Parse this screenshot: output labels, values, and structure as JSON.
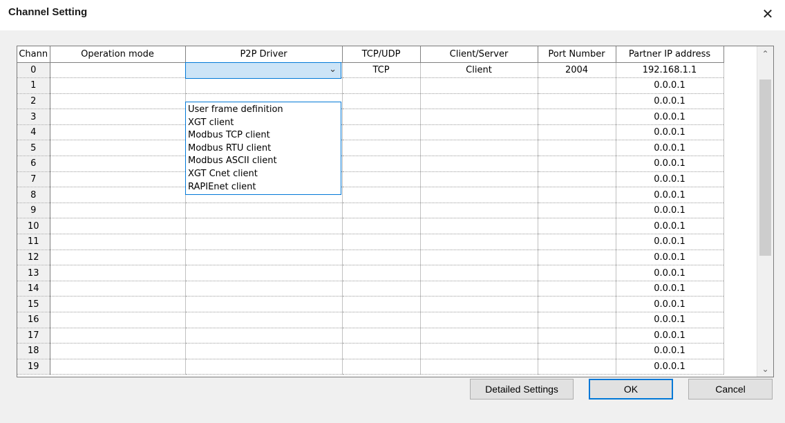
{
  "window": {
    "title": "Channel Setting",
    "close_glyph": "✕"
  },
  "grid": {
    "columns": [
      "Chann",
      "Operation mode",
      "P2P Driver",
      "TCP/UDP",
      "Client/Server",
      "Port Number",
      "Partner IP address"
    ],
    "rows": [
      {
        "channel": "0",
        "operation_mode": "",
        "p2p_driver": "",
        "tcp_udp": "TCP",
        "client_server": "Client",
        "port_number": "2004",
        "partner_ip": "192.168.1.1"
      },
      {
        "channel": "1",
        "operation_mode": "",
        "p2p_driver": "",
        "tcp_udp": "",
        "client_server": "",
        "port_number": "",
        "partner_ip": "0.0.0.1"
      },
      {
        "channel": "2",
        "operation_mode": "",
        "p2p_driver": "",
        "tcp_udp": "",
        "client_server": "",
        "port_number": "",
        "partner_ip": "0.0.0.1"
      },
      {
        "channel": "3",
        "operation_mode": "",
        "p2p_driver": "",
        "tcp_udp": "",
        "client_server": "",
        "port_number": "",
        "partner_ip": "0.0.0.1"
      },
      {
        "channel": "4",
        "operation_mode": "",
        "p2p_driver": "",
        "tcp_udp": "",
        "client_server": "",
        "port_number": "",
        "partner_ip": "0.0.0.1"
      },
      {
        "channel": "5",
        "operation_mode": "",
        "p2p_driver": "",
        "tcp_udp": "",
        "client_server": "",
        "port_number": "",
        "partner_ip": "0.0.0.1"
      },
      {
        "channel": "6",
        "operation_mode": "",
        "p2p_driver": "",
        "tcp_udp": "",
        "client_server": "",
        "port_number": "",
        "partner_ip": "0.0.0.1"
      },
      {
        "channel": "7",
        "operation_mode": "",
        "p2p_driver": "",
        "tcp_udp": "",
        "client_server": "",
        "port_number": "",
        "partner_ip": "0.0.0.1"
      },
      {
        "channel": "8",
        "operation_mode": "",
        "p2p_driver": "",
        "tcp_udp": "",
        "client_server": "",
        "port_number": "",
        "partner_ip": "0.0.0.1"
      },
      {
        "channel": "9",
        "operation_mode": "",
        "p2p_driver": "",
        "tcp_udp": "",
        "client_server": "",
        "port_number": "",
        "partner_ip": "0.0.0.1"
      },
      {
        "channel": "10",
        "operation_mode": "",
        "p2p_driver": "",
        "tcp_udp": "",
        "client_server": "",
        "port_number": "",
        "partner_ip": "0.0.0.1"
      },
      {
        "channel": "11",
        "operation_mode": "",
        "p2p_driver": "",
        "tcp_udp": "",
        "client_server": "",
        "port_number": "",
        "partner_ip": "0.0.0.1"
      },
      {
        "channel": "12",
        "operation_mode": "",
        "p2p_driver": "",
        "tcp_udp": "",
        "client_server": "",
        "port_number": "",
        "partner_ip": "0.0.0.1"
      },
      {
        "channel": "13",
        "operation_mode": "",
        "p2p_driver": "",
        "tcp_udp": "",
        "client_server": "",
        "port_number": "",
        "partner_ip": "0.0.0.1"
      },
      {
        "channel": "14",
        "operation_mode": "",
        "p2p_driver": "",
        "tcp_udp": "",
        "client_server": "",
        "port_number": "",
        "partner_ip": "0.0.0.1"
      },
      {
        "channel": "15",
        "operation_mode": "",
        "p2p_driver": "",
        "tcp_udp": "",
        "client_server": "",
        "port_number": "",
        "partner_ip": "0.0.0.1"
      },
      {
        "channel": "16",
        "operation_mode": "",
        "p2p_driver": "",
        "tcp_udp": "",
        "client_server": "",
        "port_number": "",
        "partner_ip": "0.0.0.1"
      },
      {
        "channel": "17",
        "operation_mode": "",
        "p2p_driver": "",
        "tcp_udp": "",
        "client_server": "",
        "port_number": "",
        "partner_ip": "0.0.0.1"
      },
      {
        "channel": "18",
        "operation_mode": "",
        "p2p_driver": "",
        "tcp_udp": "",
        "client_server": "",
        "port_number": "",
        "partner_ip": "0.0.0.1"
      },
      {
        "channel": "19",
        "operation_mode": "",
        "p2p_driver": "",
        "tcp_udp": "",
        "client_server": "",
        "port_number": "",
        "partner_ip": "0.0.0.1"
      }
    ]
  },
  "p2p_combo": {
    "value": "",
    "chevron_icon": "chevron-down-icon",
    "options": [
      "User frame definition",
      "XGT client",
      "Modbus TCP client",
      "Modbus RTU client",
      "Modbus ASCII client",
      "XGT Cnet client",
      "RAPIEnet client"
    ]
  },
  "scrollbar": {
    "up_icon": "scroll-up-icon",
    "down_icon": "scroll-down-icon"
  },
  "buttons": {
    "detailed_settings": "Detailed Settings",
    "ok": "OK",
    "cancel": "Cancel"
  },
  "colors": {
    "accent": "#0078d7",
    "selection": "#cce4f7",
    "dialog_bg": "#f0f0f0"
  }
}
